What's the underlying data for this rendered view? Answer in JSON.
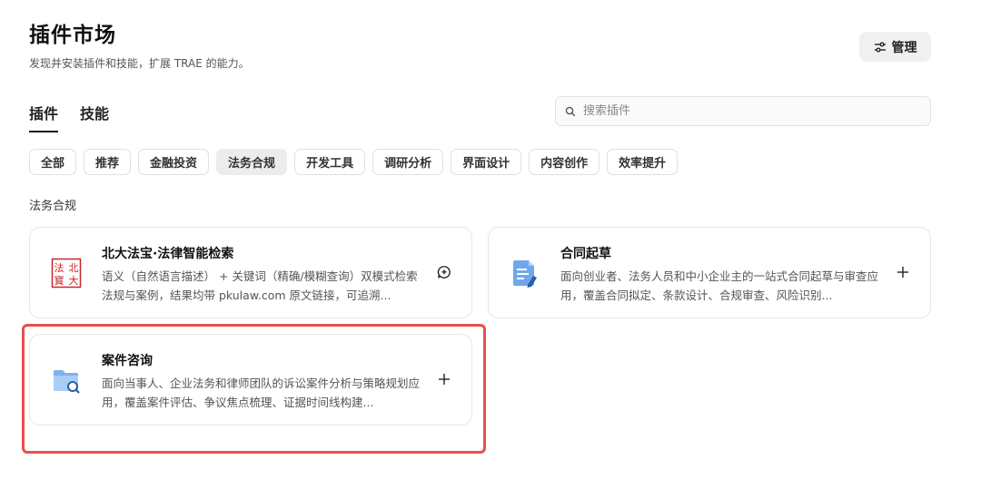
{
  "header": {
    "title": "插件市场",
    "subtitle": "发现并安装插件和技能，扩展 TRAE 的能力。",
    "manage_label": "管理"
  },
  "tabs": [
    {
      "label": "插件",
      "active": true
    },
    {
      "label": "技能",
      "active": false
    }
  ],
  "search": {
    "placeholder": "搜索插件",
    "value": ""
  },
  "categories": [
    {
      "label": "全部"
    },
    {
      "label": "推荐"
    },
    {
      "label": "金融投资"
    },
    {
      "label": "法务合规",
      "active": true
    },
    {
      "label": "开发工具"
    },
    {
      "label": "调研分析"
    },
    {
      "label": "界面设计"
    },
    {
      "label": "内容创作"
    },
    {
      "label": "效率提升"
    }
  ],
  "section_label": "法务合规",
  "plugins": [
    {
      "name": "北大法宝·法律智能检索",
      "description": "语义（自然语言描述） + 关键词（精确/模糊查询）双模式检索法规与案例，结果均带 pkulaw.com 原文链接，可追溯...",
      "icon": "pkulaw-seal-icon",
      "logo_text": "法北寳大",
      "action": "installed-icon"
    },
    {
      "name": "合同起草",
      "description": "面向创业者、法务人员和中小企业主的一站式合同起草与审查应用，覆盖合同拟定、条款设计、合规审查、风险识别...",
      "icon": "contract-document-icon",
      "action": "add-icon"
    },
    {
      "name": "案件咨询",
      "description": "面向当事人、企业法务和律师团队的诉讼案件分析与策略规划应用，覆盖案件评估、争议焦点梳理、证据时间线构建...",
      "icon": "folder-search-icon",
      "action": "add-icon"
    }
  ],
  "colors": {
    "highlight_border": "#e84f4f",
    "seal_red": "#c8262b",
    "icon_blue": "#4a90e2"
  }
}
